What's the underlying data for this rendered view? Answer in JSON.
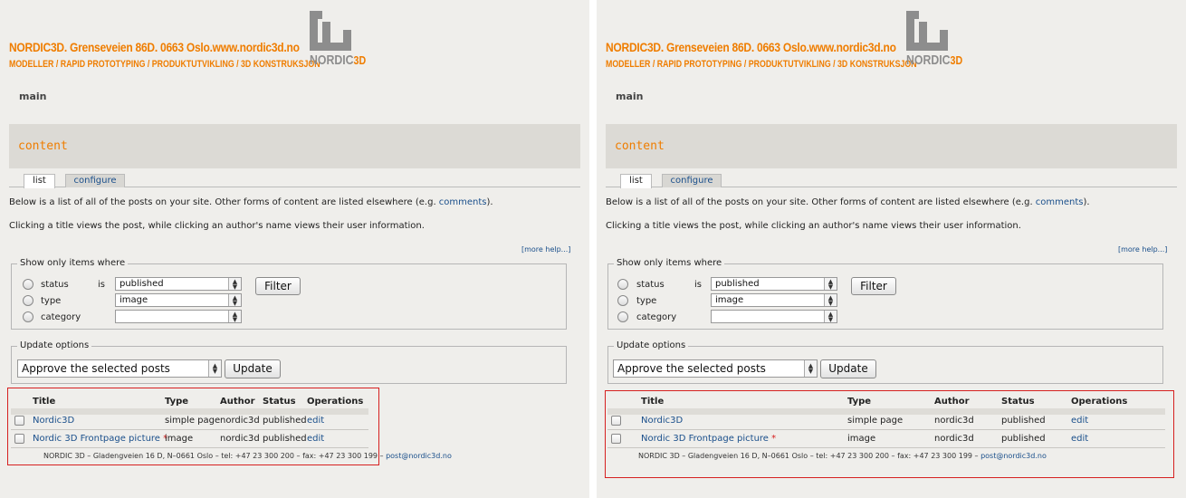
{
  "header": {
    "brand_line1": "NORDIC3D. Grenseveien 86D. 0663 Oslo.www.nordic3d.no",
    "brand_line2": "MODELLER / RAPID PROTOTYPING / PRODUKTUTVIKLING / 3D KONSTRUKSJON",
    "logo_text": "NORDIC",
    "logo_accent": "3D"
  },
  "nav": {
    "main_label": "main"
  },
  "page": {
    "title": "content"
  },
  "tabs": {
    "list": "list",
    "configure": "configure"
  },
  "intro": {
    "line1_prefix": "Below is a list of all of the posts on your site. Other forms of content are listed elsewhere (e.g. ",
    "line1_link": "comments",
    "line1_suffix": ").",
    "line2": "Clicking a title views the post, while clicking an author's name views their user information.",
    "more_help": "[more help...]"
  },
  "filter": {
    "legend": "Show only items where",
    "status_label": "status",
    "is_label": "is",
    "type_label": "type",
    "category_label": "category",
    "status_value": "published",
    "type_value": "image",
    "category_value": "",
    "filter_button": "Filter"
  },
  "update": {
    "legend": "Update options",
    "selected": "Approve the selected posts",
    "update_button": "Update"
  },
  "table": {
    "headers": {
      "title": "Title",
      "type": "Type",
      "author": "Author",
      "status": "Status",
      "operations": "Operations"
    },
    "rows": [
      {
        "title": "Nordic3D",
        "required": "",
        "type": "simple page",
        "author": "nordic3d",
        "status": "published",
        "operation": "edit"
      },
      {
        "title": "Nordic 3D Frontpage picture",
        "required": "*",
        "type": "image",
        "author": "nordic3d",
        "status": "published",
        "operation": "edit"
      }
    ]
  },
  "footer": {
    "text": "NORDIC 3D – Gladengveien 16 D, N–0661 Oslo – tel: +47 23 300 200 – fax: +47 23 300 199 – ",
    "email": "post@nordic3d.no"
  },
  "colors": {
    "brand_orange": "#ef7d00",
    "link_blue": "#1a4f8b",
    "highlight_red": "#d62020",
    "logo_grey": "#8d8d8d"
  }
}
